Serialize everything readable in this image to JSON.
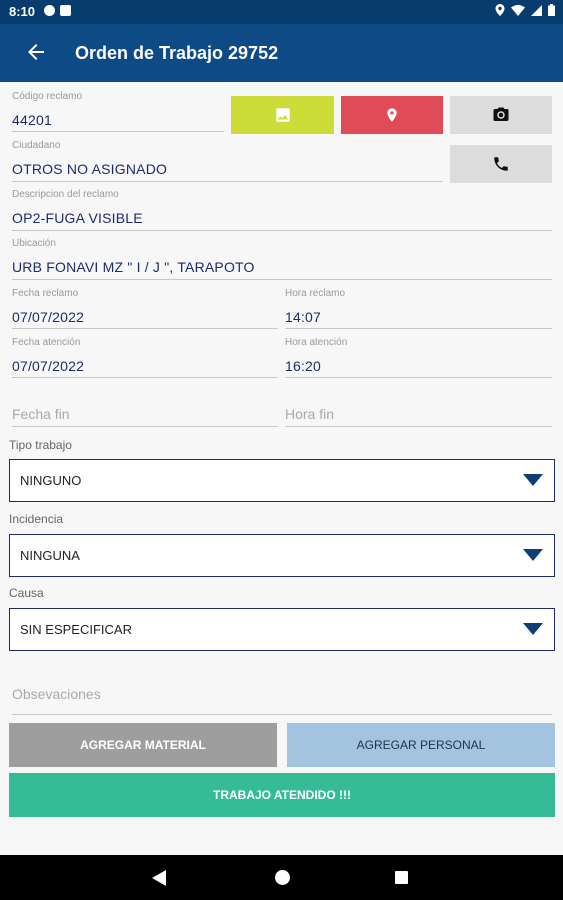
{
  "status_bar": {
    "time": "8:10"
  },
  "app_bar": {
    "title": "Orden de Trabajo 29752"
  },
  "fields": {
    "codigo": {
      "label": "Código reclamo",
      "value": "44201"
    },
    "ciudadano": {
      "label": "Ciudadano",
      "value": "OTROS NO ASIGNADO"
    },
    "descripcion": {
      "label": "Descripcion del reclamo",
      "value": "OP2-FUGA VISIBLE"
    },
    "ubicacion": {
      "label": "Ubicación",
      "value": "URB FONAVI MZ \" I / J \", TARAPOTO"
    },
    "fecha_reclamo": {
      "label": "Fecha reclamo",
      "value": "07/07/2022"
    },
    "hora_reclamo": {
      "label": "Hora reclamo",
      "value": "14:07"
    },
    "fecha_atencion": {
      "label": "Fecha atención",
      "value": "07/07/2022"
    },
    "hora_atencion": {
      "label": "Hora atención",
      "value": "16:20"
    },
    "fecha_fin": {
      "hint": "Fecha fin"
    },
    "hora_fin": {
      "hint": "Hora fin"
    },
    "observaciones": {
      "hint": "Obsevaciones"
    }
  },
  "dropdowns": {
    "tipo_trabajo": {
      "label": "Tipo trabajo",
      "value": "NINGUNO"
    },
    "incidencia": {
      "label": "Incidencia",
      "value": "NINGUNA"
    },
    "causa": {
      "label": "Causa",
      "value": "SIN ESPECIFICAR"
    }
  },
  "buttons": {
    "agregar_material": "AGREGAR MATERIAL",
    "agregar_personal": "AGREGAR PERSONAL",
    "trabajo_atendido": "TRABAJO ATENDIDO !!!"
  },
  "colors": {
    "app_bar": "#0d4a86",
    "image_button": "#cddc39",
    "location_button": "#df4c57",
    "attended_button": "#35bc97",
    "personal_button": "#a3c4e0",
    "material_button": "#9e9e9e"
  },
  "icons": {
    "back": "arrow-left-icon",
    "image": "image-icon",
    "location": "location-pin-icon",
    "camera": "camera-icon",
    "phone": "phone-icon",
    "dropdown": "triangle-down-icon"
  }
}
